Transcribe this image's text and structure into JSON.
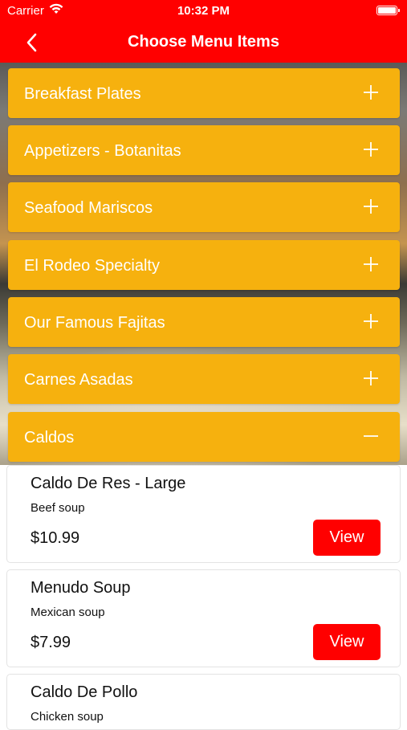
{
  "status_bar": {
    "carrier": "Carrier",
    "time": "10:32 PM"
  },
  "nav": {
    "title": "Choose Menu Items",
    "back_icon": "chevron-left-icon"
  },
  "colors": {
    "brand": "#ff0000",
    "category_bg": "#f6b10e",
    "text_on_brand": "#ffffff"
  },
  "categories": [
    {
      "label": "Breakfast Plates",
      "expanded": false
    },
    {
      "label": "Appetizers - Botanitas",
      "expanded": false
    },
    {
      "label": "Seafood Mariscos",
      "expanded": false
    },
    {
      "label": "El Rodeo Specialty",
      "expanded": false
    },
    {
      "label": "Our Famous Fajitas",
      "expanded": false
    },
    {
      "label": "Carnes Asadas",
      "expanded": false
    },
    {
      "label": "Caldos",
      "expanded": true
    }
  ],
  "items": [
    {
      "name": "Caldo De Res - Large",
      "description": "Beef soup",
      "price": "$10.99",
      "button": "View"
    },
    {
      "name": "Menudo Soup",
      "description": "Mexican soup",
      "price": "$7.99",
      "button": "View"
    },
    {
      "name": "Caldo De Pollo",
      "description": "Chicken soup",
      "price": "",
      "button": ""
    }
  ]
}
